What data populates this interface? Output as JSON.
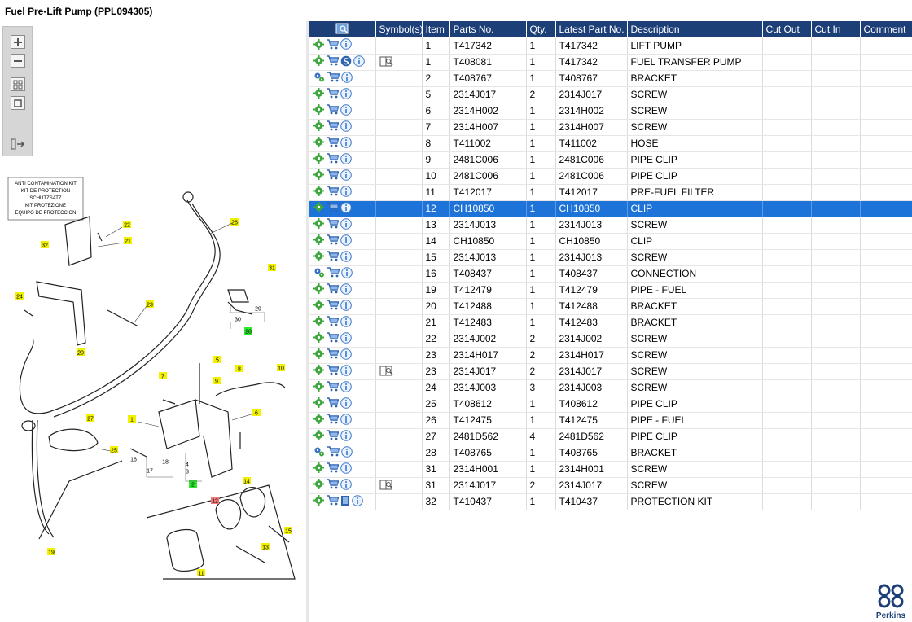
{
  "window": {
    "title": "Fuel Pre-Lift Pump (PPL094305)"
  },
  "toolbar": {
    "tools": [
      "zoom-in-icon",
      "zoom-out-icon",
      "fit-all-icon",
      "fit-window-icon",
      "export-icon"
    ]
  },
  "diagram": {
    "kit_label": [
      "ANTI CONTAMINATION KIT",
      "KIT DE PROTECTION",
      "SCHUTZSATZ",
      "KIT PROTEZIONE",
      "EQUIPO DE PROTECCION"
    ],
    "callouts": [
      "22",
      "21",
      "32",
      "26",
      "31",
      "24",
      "23",
      "20",
      "29",
      "30",
      "28",
      "5",
      "10",
      "7",
      "9",
      "8",
      "27",
      "6",
      "1",
      "25",
      "16",
      "17",
      "18",
      "4",
      "3",
      "2",
      "14",
      "12",
      "15",
      "13",
      "19",
      "11"
    ]
  },
  "grid": {
    "headers": [
      "",
      "Symbol(s)",
      "Item",
      "Parts No.",
      "Qty.",
      "Latest Part No.",
      "Description",
      "Cut Out",
      "Cut In",
      "Comment"
    ],
    "selected_row": 10,
    "rows": [
      {
        "item": "1",
        "part": "T417342",
        "qty": "1",
        "latest": "T417342",
        "desc": "LIFT PUMP",
        "cutout": "",
        "cutin": "",
        "comment": "",
        "icons": [
          "gear",
          "cart",
          "info"
        ],
        "symbols": []
      },
      {
        "item": "1",
        "part": "T408081",
        "qty": "1",
        "latest": "T417342",
        "desc": "FUEL TRANSFER PUMP",
        "cutout": "",
        "cutin": "",
        "comment": "",
        "icons": [
          "gear",
          "cart",
          "superseded",
          "info"
        ],
        "symbols": [
          "book"
        ]
      },
      {
        "item": "2",
        "part": "T408767",
        "qty": "1",
        "latest": "T408767",
        "desc": "BRACKET",
        "cutout": "",
        "cutin": "",
        "comment": "",
        "icons": [
          "gears",
          "cart",
          "info"
        ],
        "symbols": []
      },
      {
        "item": "5",
        "part": "2314J017",
        "qty": "2",
        "latest": "2314J017",
        "desc": "SCREW",
        "cutout": "",
        "cutin": "",
        "comment": "",
        "icons": [
          "gear",
          "cart",
          "info"
        ],
        "symbols": []
      },
      {
        "item": "6",
        "part": "2314H002",
        "qty": "1",
        "latest": "2314H002",
        "desc": "SCREW",
        "cutout": "",
        "cutin": "",
        "comment": "",
        "icons": [
          "gear",
          "cart",
          "info"
        ],
        "symbols": []
      },
      {
        "item": "7",
        "part": "2314H007",
        "qty": "1",
        "latest": "2314H007",
        "desc": "SCREW",
        "cutout": "",
        "cutin": "",
        "comment": "",
        "icons": [
          "gear",
          "cart",
          "info"
        ],
        "symbols": []
      },
      {
        "item": "8",
        "part": "T411002",
        "qty": "1",
        "latest": "T411002",
        "desc": "HOSE",
        "cutout": "",
        "cutin": "",
        "comment": "",
        "icons": [
          "gear",
          "cart",
          "info"
        ],
        "symbols": []
      },
      {
        "item": "9",
        "part": "2481C006",
        "qty": "1",
        "latest": "2481C006",
        "desc": "PIPE CLIP",
        "cutout": "",
        "cutin": "",
        "comment": "",
        "icons": [
          "gear",
          "cart",
          "info"
        ],
        "symbols": []
      },
      {
        "item": "10",
        "part": "2481C006",
        "qty": "1",
        "latest": "2481C006",
        "desc": "PIPE CLIP",
        "cutout": "",
        "cutin": "",
        "comment": "",
        "icons": [
          "gear",
          "cart",
          "info"
        ],
        "symbols": []
      },
      {
        "item": "11",
        "part": "T412017",
        "qty": "1",
        "latest": "T412017",
        "desc": "PRE-FUEL FILTER",
        "cutout": "",
        "cutin": "",
        "comment": "",
        "icons": [
          "gear",
          "cart",
          "info"
        ],
        "symbols": []
      },
      {
        "item": "12",
        "part": "CH10850",
        "qty": "1",
        "latest": "CH10850",
        "desc": "CLIP",
        "cutout": "",
        "cutin": "",
        "comment": "",
        "icons": [
          "gear",
          "cart",
          "info"
        ],
        "symbols": []
      },
      {
        "item": "13",
        "part": "2314J013",
        "qty": "1",
        "latest": "2314J013",
        "desc": "SCREW",
        "cutout": "",
        "cutin": "",
        "comment": "",
        "icons": [
          "gear",
          "cart",
          "info"
        ],
        "symbols": []
      },
      {
        "item": "14",
        "part": "CH10850",
        "qty": "1",
        "latest": "CH10850",
        "desc": "CLIP",
        "cutout": "",
        "cutin": "",
        "comment": "",
        "icons": [
          "gear",
          "cart",
          "info"
        ],
        "symbols": []
      },
      {
        "item": "15",
        "part": "2314J013",
        "qty": "1",
        "latest": "2314J013",
        "desc": "SCREW",
        "cutout": "",
        "cutin": "",
        "comment": "",
        "icons": [
          "gear",
          "cart",
          "info"
        ],
        "symbols": []
      },
      {
        "item": "16",
        "part": "T408437",
        "qty": "1",
        "latest": "T408437",
        "desc": "CONNECTION",
        "cutout": "",
        "cutin": "",
        "comment": "",
        "icons": [
          "gears",
          "cart",
          "info"
        ],
        "symbols": []
      },
      {
        "item": "19",
        "part": "T412479",
        "qty": "1",
        "latest": "T412479",
        "desc": "PIPE - FUEL",
        "cutout": "",
        "cutin": "",
        "comment": "",
        "icons": [
          "gear",
          "cart",
          "info"
        ],
        "symbols": []
      },
      {
        "item": "20",
        "part": "T412488",
        "qty": "1",
        "latest": "T412488",
        "desc": "BRACKET",
        "cutout": "",
        "cutin": "",
        "comment": "",
        "icons": [
          "gear",
          "cart",
          "info"
        ],
        "symbols": []
      },
      {
        "item": "21",
        "part": "T412483",
        "qty": "1",
        "latest": "T412483",
        "desc": "BRACKET",
        "cutout": "",
        "cutin": "",
        "comment": "",
        "icons": [
          "gear",
          "cart",
          "info"
        ],
        "symbols": []
      },
      {
        "item": "22",
        "part": "2314J002",
        "qty": "2",
        "latest": "2314J002",
        "desc": "SCREW",
        "cutout": "",
        "cutin": "",
        "comment": "",
        "icons": [
          "gear",
          "cart",
          "info"
        ],
        "symbols": []
      },
      {
        "item": "23",
        "part": "2314H017",
        "qty": "2",
        "latest": "2314H017",
        "desc": "SCREW",
        "cutout": "",
        "cutin": "",
        "comment": "",
        "icons": [
          "gear",
          "cart",
          "info"
        ],
        "symbols": []
      },
      {
        "item": "23",
        "part": "2314J017",
        "qty": "2",
        "latest": "2314J017",
        "desc": "SCREW",
        "cutout": "",
        "cutin": "",
        "comment": "",
        "icons": [
          "gear",
          "cart",
          "info"
        ],
        "symbols": [
          "book"
        ]
      },
      {
        "item": "24",
        "part": "2314J003",
        "qty": "3",
        "latest": "2314J003",
        "desc": "SCREW",
        "cutout": "",
        "cutin": "",
        "comment": "",
        "icons": [
          "gear",
          "cart",
          "info"
        ],
        "symbols": []
      },
      {
        "item": "25",
        "part": "T408612",
        "qty": "1",
        "latest": "T408612",
        "desc": "PIPE CLIP",
        "cutout": "",
        "cutin": "",
        "comment": "",
        "icons": [
          "gear",
          "cart",
          "info"
        ],
        "symbols": []
      },
      {
        "item": "26",
        "part": "T412475",
        "qty": "1",
        "latest": "T412475",
        "desc": "PIPE - FUEL",
        "cutout": "",
        "cutin": "",
        "comment": "",
        "icons": [
          "gear",
          "cart",
          "info"
        ],
        "symbols": []
      },
      {
        "item": "27",
        "part": "2481D562",
        "qty": "4",
        "latest": "2481D562",
        "desc": "PIPE CLIP",
        "cutout": "",
        "cutin": "",
        "comment": "",
        "icons": [
          "gear",
          "cart",
          "info"
        ],
        "symbols": []
      },
      {
        "item": "28",
        "part": "T408765",
        "qty": "1",
        "latest": "T408765",
        "desc": "BRACKET",
        "cutout": "",
        "cutin": "",
        "comment": "",
        "icons": [
          "gears",
          "cart",
          "info"
        ],
        "symbols": []
      },
      {
        "item": "31",
        "part": "2314H001",
        "qty": "1",
        "latest": "2314H001",
        "desc": "SCREW",
        "cutout": "",
        "cutin": "",
        "comment": "",
        "icons": [
          "gear",
          "cart",
          "info"
        ],
        "symbols": []
      },
      {
        "item": "31",
        "part": "2314J017",
        "qty": "2",
        "latest": "2314J017",
        "desc": "SCREW",
        "cutout": "",
        "cutin": "",
        "comment": "",
        "icons": [
          "gear",
          "cart",
          "info"
        ],
        "symbols": [
          "book"
        ]
      },
      {
        "item": "32",
        "part": "T410437",
        "qty": "1",
        "latest": "T410437",
        "desc": "PROTECTION KIT",
        "cutout": "",
        "cutin": "",
        "comment": "",
        "icons": [
          "gear",
          "cart",
          "doc",
          "info"
        ],
        "symbols": []
      }
    ]
  },
  "brand": {
    "name": "Perkins",
    "color": "#1d3f78"
  },
  "colors": {
    "header": "#1d3f78",
    "selected": "#1e73d8",
    "callout_yellow": "#f2f200",
    "callout_green": "#2ee82e",
    "callout_red": "#f07a7a"
  }
}
